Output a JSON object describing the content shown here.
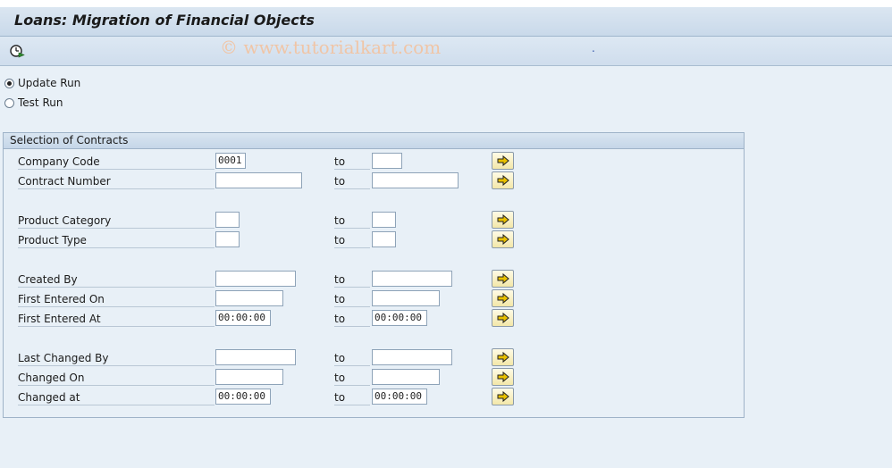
{
  "title": "Loans: Migration of Financial Objects",
  "toolbar": {
    "execute_icon": "execute-clock-icon"
  },
  "watermark": "© www.tutorialkart.com",
  "toolbar_dot": ".",
  "run_options": [
    {
      "label": "Update Run",
      "selected": true
    },
    {
      "label": "Test Run",
      "selected": false
    }
  ],
  "group": {
    "title": "Selection of Contracts",
    "to_label": "to",
    "rows": [
      {
        "label": "Company Code",
        "low": "0001",
        "high": ""
      },
      {
        "label": "Contract Number",
        "low": "",
        "high": ""
      },
      {
        "label": "Product Category",
        "low": "",
        "high": ""
      },
      {
        "label": "Product Type",
        "low": "",
        "high": ""
      },
      {
        "label": "Created By",
        "low": "",
        "high": ""
      },
      {
        "label": "First Entered On",
        "low": "",
        "high": ""
      },
      {
        "label": "First Entered At",
        "low": "00:00:00",
        "high": "00:00:00"
      },
      {
        "label": "Last Changed By",
        "low": "",
        "high": ""
      },
      {
        "label": "Changed On",
        "low": "",
        "high": ""
      },
      {
        "label": "Changed at",
        "low": "00:00:00",
        "high": "00:00:00"
      }
    ]
  },
  "colors": {
    "background": "#e8f0f7",
    "multisel_button": "#f3e7a8",
    "arrow": "#e0b400"
  }
}
